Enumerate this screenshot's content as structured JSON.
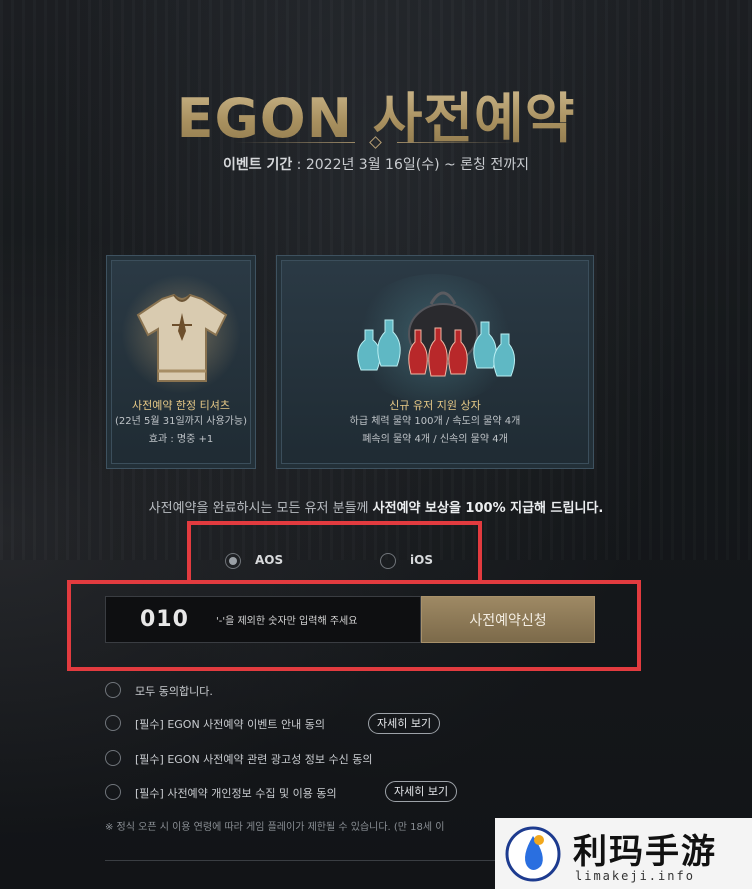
{
  "header": {
    "title": "EGON 사전예약",
    "period_label": "이벤트 기간",
    "period_value": " : 2022년 3월 16일(수) ~ 론칭 전까지"
  },
  "rewards": [
    {
      "name": "사전예약 한정 티셔츠",
      "note": "(22년 5월 31일까지 사용가능)",
      "effect": "효과 : 명중 +1"
    },
    {
      "name": "신규 유저 지원 상자",
      "line1": "하급 체력 물약 100개 / 속도의 물약 4개",
      "line2": "폐속의 물약 4개 / 신속의 물약 4개"
    }
  ],
  "notice": {
    "normal": "사전예약을 완료하시는 모든 유저 분들께 ",
    "bold": "사전예약 보상을 100% 지급해 드립니다."
  },
  "platform": {
    "options": [
      "AOS",
      "iOS"
    ],
    "selected": "AOS"
  },
  "phone": {
    "prefix": "010",
    "placeholder": "'-'을 제외한 숫자만 입력해 주세요"
  },
  "submit_label": "사전예약신청",
  "agreements": [
    {
      "label": "모두 동의합니다.",
      "detail": ""
    },
    {
      "label": "[필수] EGON 사전예약 이벤트 안내 동의",
      "detail": "자세히 보기"
    },
    {
      "label": "[필수] EGON 사전예약 관련 광고성 정보 수신 동의",
      "detail": ""
    },
    {
      "label": "[필수] 사전예약 개인정보 수집 및 이용 동의",
      "detail": "자세히 보기"
    }
  ],
  "footnote": "※ 정식 오픈 시 이용 연령에 따라 게임 플레이가 제한될 수 있습니다. (만 18세 이",
  "watermark": {
    "name": "利玛手游",
    "url": "limakeji.info"
  },
  "colors": {
    "accent_gold": "#b79f74",
    "highlight_red": "#e23b3f",
    "card_bg": "#2b3a45"
  }
}
